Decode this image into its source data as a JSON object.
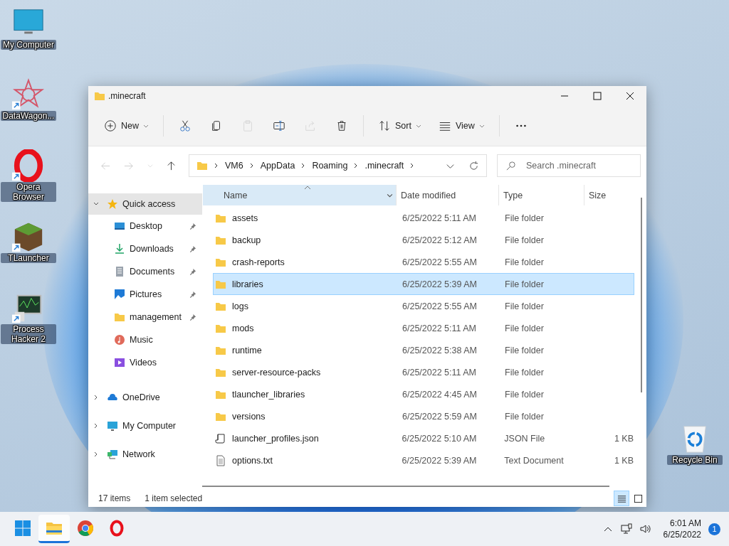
{
  "desktop_icons": [
    {
      "label": "My Computer",
      "kind": "monitor",
      "shortcut": false
    },
    {
      "label": "DataWagon...",
      "kind": "star",
      "shortcut": true
    },
    {
      "label": "Opera Browser",
      "kind": "opera",
      "shortcut": true
    },
    {
      "label": "TLauncher",
      "kind": "block",
      "shortcut": true
    },
    {
      "label": "Process Hacker 2",
      "kind": "hacker",
      "shortcut": true
    }
  ],
  "recycle_bin": {
    "label": "Recycle Bin"
  },
  "window": {
    "title": ".minecraft"
  },
  "toolbar": [
    {
      "kind": "new",
      "label": "New",
      "disabled": false
    },
    {
      "kind": "cut",
      "disabled": false
    },
    {
      "kind": "copy",
      "disabled": false
    },
    {
      "kind": "paste",
      "disabled": true
    },
    {
      "kind": "rename",
      "disabled": false
    },
    {
      "kind": "share",
      "disabled": true
    },
    {
      "kind": "delete",
      "disabled": false
    },
    {
      "kind": "sort",
      "label": "Sort",
      "disabled": false
    },
    {
      "kind": "view",
      "label": "View",
      "disabled": false
    },
    {
      "kind": "more",
      "disabled": false
    }
  ],
  "navigation": [
    {
      "kind": "back",
      "disabled": true
    },
    {
      "kind": "forward",
      "disabled": true
    },
    {
      "kind": "recent",
      "disabled": true
    },
    {
      "kind": "up",
      "disabled": false
    }
  ],
  "address": {
    "segments": [
      "VM6",
      "AppData",
      "Roaming",
      ".minecraft"
    ]
  },
  "search": {
    "placeholder": "Search .minecraft"
  },
  "sidebar": {
    "items": [
      {
        "label": "Quick access",
        "kind": "star",
        "expanded": true,
        "selected": true,
        "children": [
          {
            "label": "Desktop",
            "kind": "desktop",
            "pinned": true,
            "selected": false
          },
          {
            "label": "Downloads",
            "kind": "download",
            "pinned": true,
            "selected": false
          },
          {
            "label": "Documents",
            "kind": "documents",
            "pinned": true,
            "selected": false
          },
          {
            "label": "Pictures",
            "kind": "pictures",
            "pinned": true,
            "selected": false
          },
          {
            "label": "management",
            "kind": "folder",
            "pinned": true,
            "selected": false
          },
          {
            "label": "Music",
            "kind": "music",
            "pinned": false,
            "selected": false
          },
          {
            "label": "Videos",
            "kind": "videos",
            "pinned": false,
            "selected": false
          }
        ]
      },
      {
        "label": "OneDrive",
        "kind": "cloud",
        "expanded": false,
        "selected": false
      },
      {
        "label": "My Computer",
        "kind": "monitor",
        "expanded": false,
        "selected": false
      },
      {
        "label": "Network",
        "kind": "network",
        "expanded": false,
        "selected": false
      }
    ]
  },
  "table": {
    "columns": [
      {
        "label": "Name",
        "sorted": true
      },
      {
        "label": "Date modified",
        "sorted": false
      },
      {
        "label": "Type",
        "sorted": false
      },
      {
        "label": "Size",
        "sorted": false
      }
    ],
    "rows": [
      {
        "name": "assets",
        "date": "6/25/2022 5:11 AM",
        "type": "File folder",
        "kind": "folder",
        "selected": false
      },
      {
        "name": "backup",
        "date": "6/25/2022 5:12 AM",
        "type": "File folder",
        "kind": "folder",
        "selected": false
      },
      {
        "name": "crash-reports",
        "date": "6/25/2022 5:55 AM",
        "type": "File folder",
        "kind": "folder",
        "selected": false
      },
      {
        "name": "libraries",
        "date": "6/25/2022 5:39 AM",
        "type": "File folder",
        "kind": "folder",
        "selected": true
      },
      {
        "name": "logs",
        "date": "6/25/2022 5:55 AM",
        "type": "File folder",
        "kind": "folder",
        "selected": false
      },
      {
        "name": "mods",
        "date": "6/25/2022 5:11 AM",
        "type": "File folder",
        "kind": "folder",
        "selected": false
      },
      {
        "name": "runtime",
        "date": "6/25/2022 5:38 AM",
        "type": "File folder",
        "kind": "folder",
        "selected": false
      },
      {
        "name": "server-resource-packs",
        "date": "6/25/2022 5:11 AM",
        "type": "File folder",
        "kind": "folder",
        "selected": false
      },
      {
        "name": "tlauncher_libraries",
        "date": "6/25/2022 4:45 AM",
        "type": "File folder",
        "kind": "folder",
        "selected": false
      },
      {
        "name": "versions",
        "date": "6/25/2022 5:59 AM",
        "type": "File folder",
        "kind": "folder",
        "selected": false
      },
      {
        "name": "launcher_profiles.json",
        "date": "6/25/2022 5:10 AM",
        "type": "JSON File",
        "size": "1 KB",
        "kind": "json",
        "selected": false
      },
      {
        "name": "options.txt",
        "date": "6/25/2022 5:39 AM",
        "type": "Text Document",
        "size": "1 KB",
        "kind": "text",
        "selected": false
      }
    ]
  },
  "status_bar": {
    "count": "17 items",
    "selection": "1 item selected",
    "views": [
      {
        "kind": "details",
        "selected": true
      },
      {
        "kind": "tiles",
        "selected": false
      }
    ]
  },
  "taskbar": {
    "apps": [
      {
        "kind": "start",
        "active": false
      },
      {
        "kind": "explorer",
        "active": true
      },
      {
        "kind": "chrome",
        "active": false
      },
      {
        "kind": "opera",
        "active": false
      }
    ],
    "time": "6:01 AM",
    "date": "6/25/2022",
    "notifications": "1"
  }
}
